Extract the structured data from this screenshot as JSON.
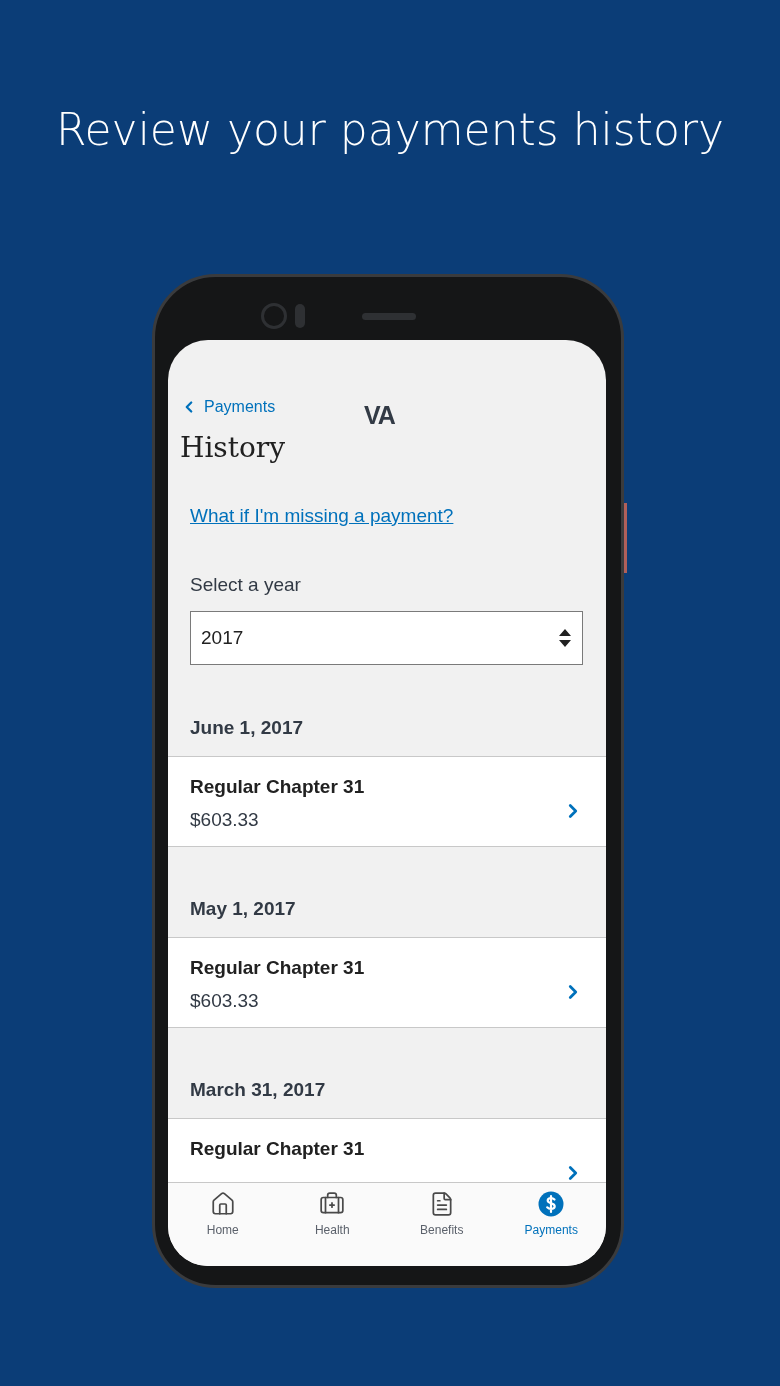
{
  "headline": "Review your payments history",
  "header": {
    "back": "Payments",
    "logo": "VA"
  },
  "title": "History",
  "help_link": "What if I'm missing a payment?",
  "year_select": {
    "label": "Select a year",
    "value": "2017"
  },
  "payments": [
    {
      "date": "June 1, 2017",
      "title": "Regular Chapter 31",
      "amount": "$603.33"
    },
    {
      "date": "May 1, 2017",
      "title": "Regular Chapter 31",
      "amount": "$603.33"
    },
    {
      "date": "March 31, 2017",
      "title": "Regular Chapter 31"
    }
  ],
  "tabs": [
    {
      "label": "Home",
      "kind": "home",
      "selected": false
    },
    {
      "label": "Health",
      "kind": "health",
      "selected": false
    },
    {
      "label": "Benefits",
      "kind": "benefits",
      "selected": false
    },
    {
      "label": "Payments",
      "kind": "payments",
      "selected": true
    }
  ]
}
